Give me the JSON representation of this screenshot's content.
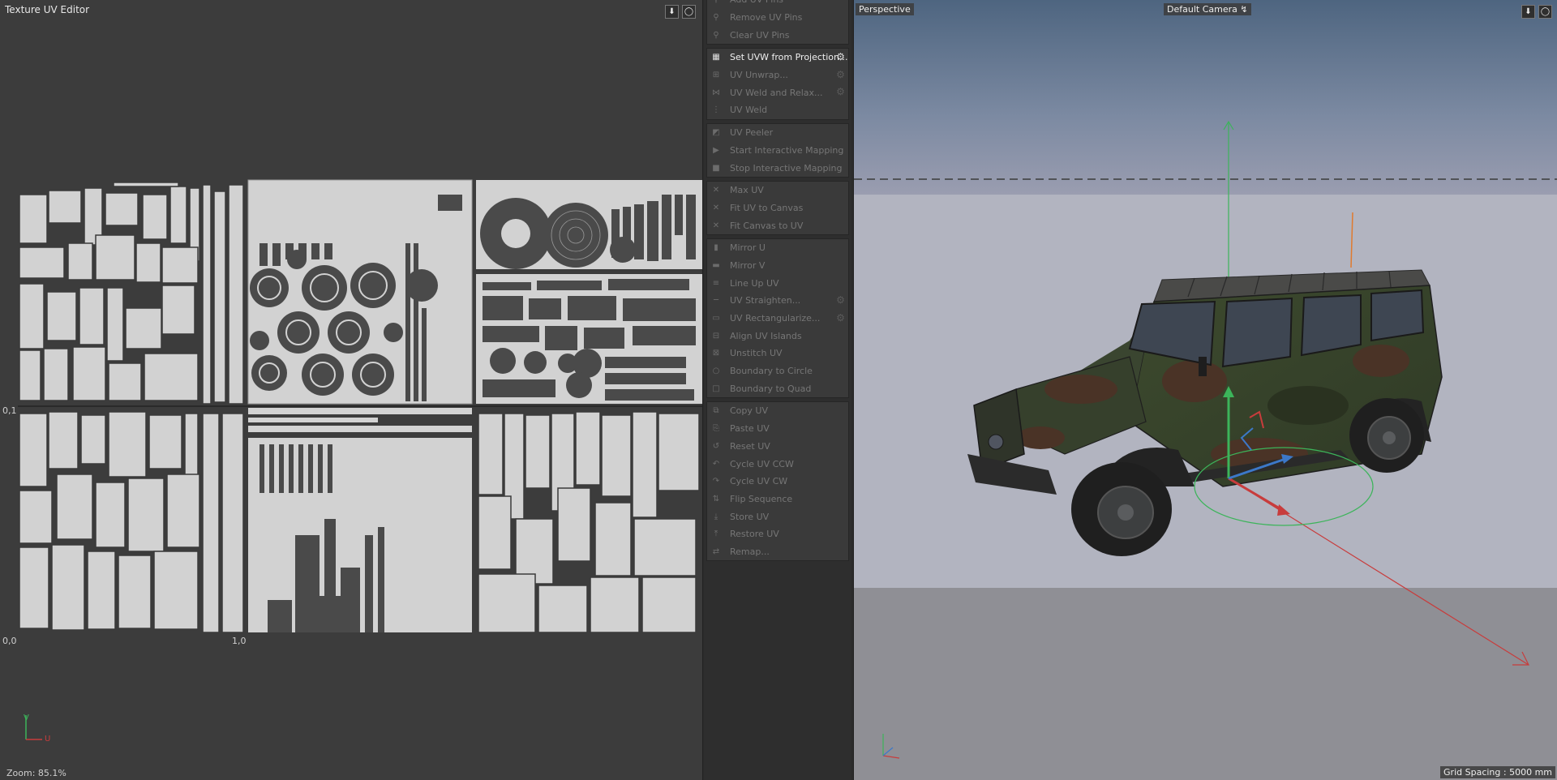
{
  "uv_editor": {
    "title": "Texture UV Editor",
    "label_v1": "0,1",
    "label_origin": "0,0",
    "label_u1": "1,0",
    "zoom": "Zoom: 85.1%",
    "axis_v": "V",
    "axis_u": "U",
    "header_icons": [
      "pin-icon",
      "refresh-icon"
    ]
  },
  "menu": {
    "groups": [
      {
        "items": [
          {
            "label": "Add UV Pins",
            "icon": "pin-icon",
            "active": false
          },
          {
            "label": "Remove UV Pins",
            "icon": "pin-remove-icon",
            "active": false
          },
          {
            "label": "Clear UV Pins",
            "icon": "pin-clear-icon",
            "active": false
          }
        ]
      },
      {
        "items": [
          {
            "label": "Set UVW from Projection...",
            "icon": "checker-icon",
            "active": true,
            "gear": true
          },
          {
            "label": "UV Unwrap...",
            "icon": "unwrap-icon",
            "active": false,
            "gear": true
          },
          {
            "label": "UV Weld and Relax...",
            "icon": "weld-relax-icon",
            "active": false,
            "gear": true
          },
          {
            "label": "UV Weld",
            "icon": "weld-icon",
            "active": false
          }
        ]
      },
      {
        "items": [
          {
            "label": "UV Peeler",
            "icon": "peeler-icon",
            "active": false
          },
          {
            "label": "Start Interactive Mapping",
            "icon": "interactive-start-icon",
            "active": false
          },
          {
            "label": "Stop Interactive Mapping",
            "icon": "interactive-stop-icon",
            "active": false
          }
        ]
      },
      {
        "items": [
          {
            "label": "Max UV",
            "icon": "max-uv-icon",
            "active": false
          },
          {
            "label": "Fit UV to Canvas",
            "icon": "fit-uv-icon",
            "active": false
          },
          {
            "label": "Fit Canvas to UV",
            "icon": "fit-canvas-icon",
            "active": false
          }
        ]
      },
      {
        "items": [
          {
            "label": "Mirror U",
            "icon": "mirror-u-icon",
            "active": false
          },
          {
            "label": "Mirror V",
            "icon": "mirror-v-icon",
            "active": false
          },
          {
            "label": "Line Up UV",
            "icon": "line-up-icon",
            "active": false
          },
          {
            "label": "UV Straighten...",
            "icon": "straighten-icon",
            "active": false,
            "gear": true
          },
          {
            "label": "UV Rectangularize...",
            "icon": "rectangularize-icon",
            "active": false,
            "gear": true
          },
          {
            "label": "Align UV Islands",
            "icon": "align-icon",
            "active": false
          },
          {
            "label": "Unstitch UV",
            "icon": "unstitch-icon",
            "active": false
          },
          {
            "label": "Boundary to Circle",
            "icon": "circle-icon",
            "active": false
          },
          {
            "label": "Boundary to Quad",
            "icon": "quad-icon",
            "active": false
          }
        ]
      },
      {
        "items": [
          {
            "label": "Copy UV",
            "icon": "copy-icon",
            "active": false
          },
          {
            "label": "Paste UV",
            "icon": "paste-icon",
            "active": false
          },
          {
            "label": "Reset UV",
            "icon": "reset-icon",
            "active": false
          },
          {
            "label": "Cycle UV CCW",
            "icon": "ccw-icon",
            "active": false
          },
          {
            "label": "Cycle UV CW",
            "icon": "cw-icon",
            "active": false
          },
          {
            "label": "Flip Sequence",
            "icon": "flip-icon",
            "active": false
          },
          {
            "label": "Store UV",
            "icon": "store-icon",
            "active": false
          },
          {
            "label": "Restore UV",
            "icon": "restore-icon",
            "active": false
          },
          {
            "label": "Remap...",
            "icon": "remap-icon",
            "active": false
          }
        ]
      }
    ]
  },
  "viewport": {
    "view_name": "Perspective",
    "camera": "Default Camera",
    "grid_spacing": "Grid Spacing : 5000 mm",
    "header_icons": [
      "pin-icon",
      "refresh-icon"
    ]
  },
  "colors": {
    "panel_bg": "#3c3c3c",
    "uv_fill": "#d2d2d2",
    "axis_x": "#c83c3c",
    "axis_y": "#3cb45a",
    "axis_z": "#3c78c8",
    "camo_green": "#3d4a2e",
    "camo_brown": "#4a3326"
  }
}
